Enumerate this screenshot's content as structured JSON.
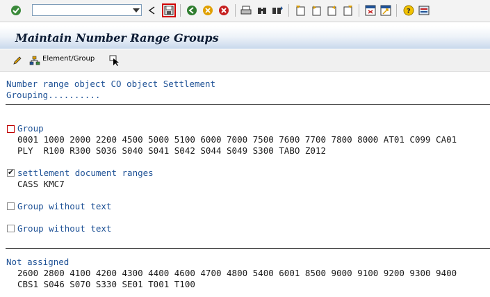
{
  "toolbar": {
    "command_field_value": "",
    "icons": [
      "enter-icon",
      "back-icon",
      "save-icon",
      "back-nav-icon",
      "exit-icon",
      "cancel-icon",
      "print-icon",
      "find-icon",
      "find-next-icon",
      "first-page-icon",
      "prev-page-icon",
      "next-page-icon",
      "last-page-icon",
      "new-session-icon",
      "shortcut-icon",
      "help-icon",
      "layout-icon"
    ]
  },
  "title": "Maintain Number Range Groups",
  "app_toolbar": {
    "element_group_label": "Element/Group"
  },
  "header": {
    "line1": "Number range object CO object Settlement",
    "line2": "Grouping.........."
  },
  "groups": [
    {
      "name": "Group",
      "checked": false,
      "values_line1": "0001 1000 2000 2200 4500 5000 5100 6000 7000 7500 7600 7700 7800 8000 AT01 C099 CA01",
      "values_line2": "PLY  R100 R300 S036 S040 S041 S042 S044 S049 S300 TABO Z012"
    },
    {
      "name": "settlement document ranges",
      "checked": true,
      "values_line1": "CASS KMC7"
    },
    {
      "name": "Group without text",
      "checked": false
    },
    {
      "name": "Group without text",
      "checked": false
    }
  ],
  "not_assigned": {
    "label": "Not assigned",
    "values_line1": "2600 2800 4100 4200 4300 4400 4600 4700 4800 5400 6001 8500 9000 9100 9200 9300 9400",
    "values_line2": "CBS1 S046 S070 S330 SE01 T001 T100"
  },
  "colors": {
    "text_blue": "#1f5296",
    "title_band_end": "#c9d9ec",
    "selection_red": "#c00000"
  }
}
